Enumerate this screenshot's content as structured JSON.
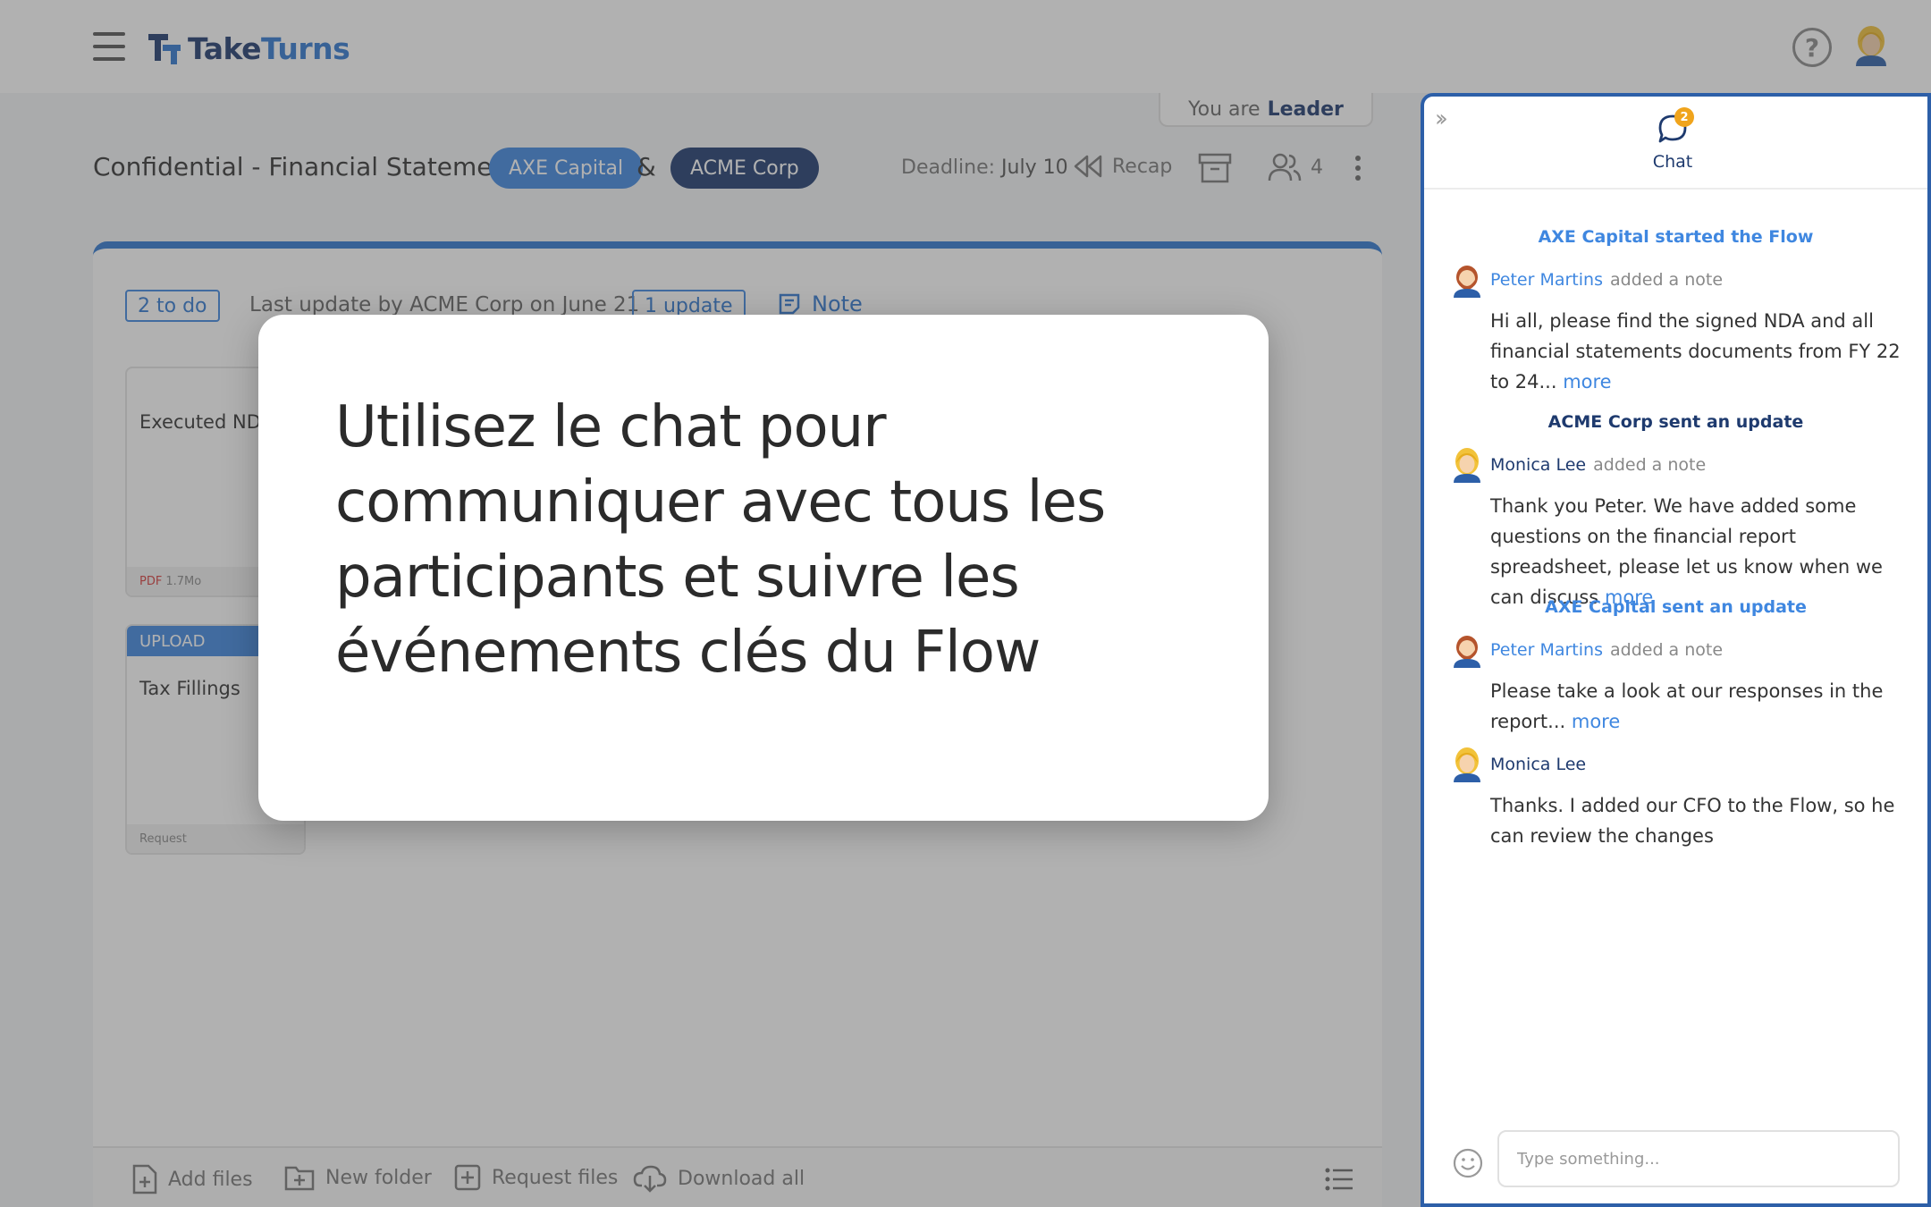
{
  "app": {
    "brand_take": "Take",
    "brand_turns": "Turns"
  },
  "role": {
    "prefix": "You are",
    "value": "Leader"
  },
  "flow": {
    "title": "Confidential - Financial Statements",
    "party_a": "AXE Capital",
    "amp": "&",
    "party_b": "ACME Corp",
    "deadline_label": "Deadline:",
    "deadline_value": "July 10",
    "recap_label": "Recap",
    "participants_count": "4"
  },
  "card": {
    "todo": "2 to do",
    "last_update": "Last update by ACME Corp on June 21",
    "update_badge": "1 update",
    "note_label": "Note",
    "files": [
      {
        "name": "Executed NDA",
        "type": "PDF",
        "size": "1.7Mo"
      },
      {
        "band": "UPLOAD",
        "name": "Tax Fillings",
        "footer": "Request"
      }
    ]
  },
  "bottom_bar": {
    "add_files": "Add files",
    "new_folder": "New folder",
    "request_files": "Request files",
    "download_all": "Download all"
  },
  "chat": {
    "tab_label": "Chat",
    "unread_count": "2",
    "events": [
      {
        "text": "AXE Capital started the Flow"
      },
      {
        "text": "ACME Corp sent an update"
      },
      {
        "text": "AXE Capital sent an update"
      }
    ],
    "messages": [
      {
        "author": "Peter Martins",
        "action": "added a note",
        "body": "Hi all, please find the signed NDA and all financial statements documents from FY 22 to 24...",
        "more": "more"
      },
      {
        "author": "Monica Lee",
        "action": "added a note",
        "body": "Thank you Peter. We have added some questions on the financial report spreadsheet, please let us know when we can discuss",
        "more": "more"
      },
      {
        "author": "Peter Martins",
        "action": "added a note",
        "body": "Please take a look at our responses in the report...",
        "more": "more"
      },
      {
        "author": "Monica Lee",
        "action": "",
        "body": "Thanks. I added our CFO to the Flow, so he can review the changes",
        "more": ""
      }
    ],
    "input_placeholder": "Type something..."
  },
  "tour": {
    "text": "Utilisez le chat pour communiquer avec tous les participants et suivre les événements clés du Flow"
  },
  "colors": {
    "primary": "#2f78d0",
    "navy": "#1e3a6e",
    "badge": "#f0a41c",
    "overlay": "rgba(70,70,70,0.42)"
  },
  "icons": [
    "menu-icon",
    "logo-icon",
    "help-icon",
    "user-avatar",
    "recap-icon",
    "archive-icon",
    "people-icon",
    "more-vert-icon",
    "note-icon",
    "add-file-icon",
    "new-folder-icon",
    "request-files-icon",
    "download-icon",
    "list-view-icon",
    "collapse-icon",
    "chat-icon",
    "emoji-icon"
  ]
}
